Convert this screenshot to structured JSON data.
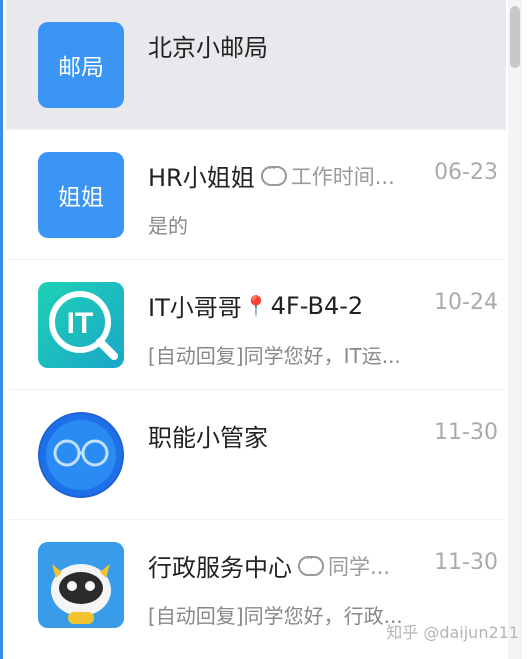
{
  "conversations": [
    {
      "name": "北京小邮局",
      "avatar_text": "邮局",
      "tag": "",
      "time": "",
      "preview": ""
    },
    {
      "name": "HR小姐姐",
      "avatar_text": "姐姐",
      "tag": "工作时间...",
      "time": "06-23",
      "preview": "是的"
    },
    {
      "name": "IT小哥哥",
      "avatar_text": "IT",
      "location": "4F-B4-2",
      "time": "10-24",
      "preview": "[自动回复]同学您好，IT运..."
    },
    {
      "name": "职能小管家",
      "time": "11-30",
      "preview": ""
    },
    {
      "name": "行政服务中心",
      "tag": "同学...",
      "time": "11-30",
      "preview": "[自动回复]同学您好，行政..."
    }
  ],
  "watermark": "知乎 @daijun211",
  "colors": {
    "accent": "#3a95f5",
    "selected_bg": "#e9e9ed",
    "it_teal": "#27c2b0"
  }
}
